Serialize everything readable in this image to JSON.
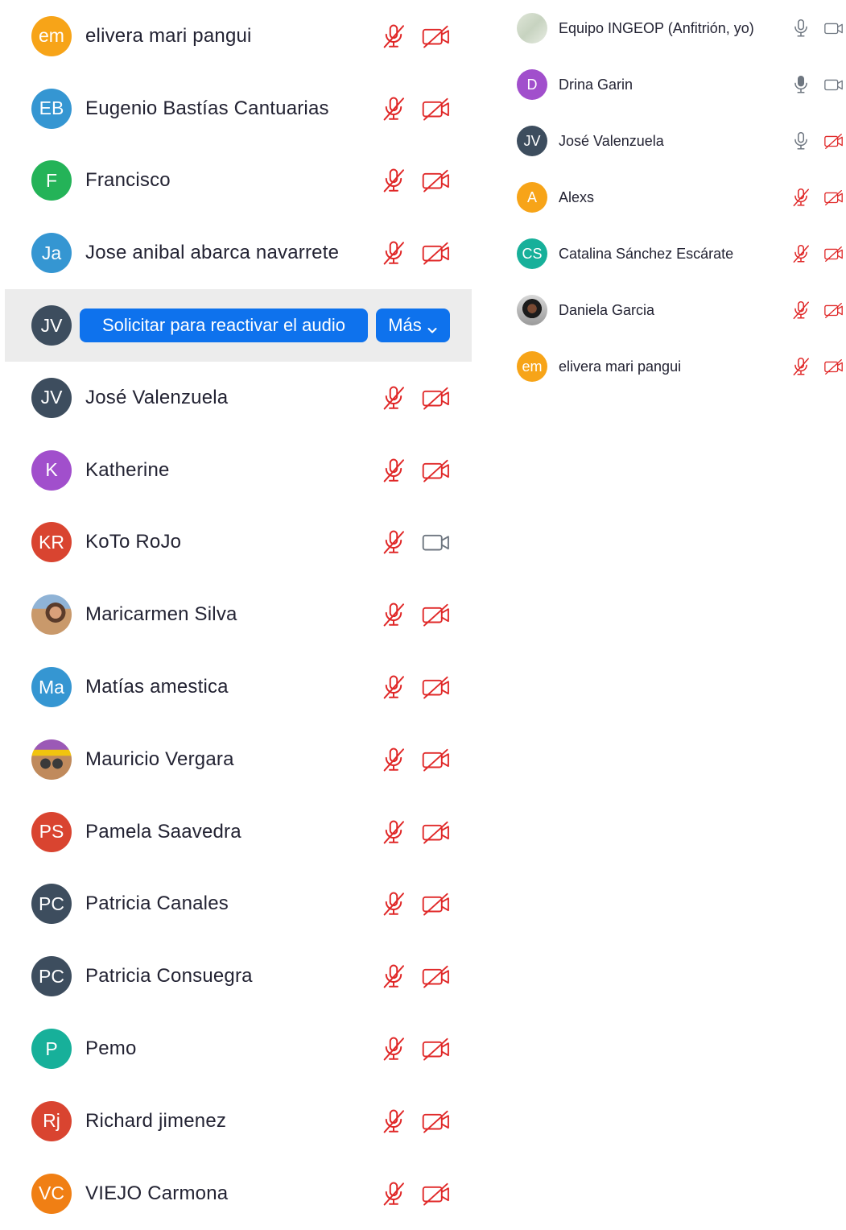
{
  "colors": {
    "muted_red": "#e02828",
    "icon_gray": "#6e7680",
    "button_blue": "#0e72ed",
    "hover_row": "#ececec"
  },
  "left_list": {
    "participants": [
      {
        "initials": "em",
        "name": "elivera mari pangui",
        "avatar_color": "#f7a418",
        "mic": "muted",
        "video": "off"
      },
      {
        "initials": "EB",
        "name": "Eugenio Bastías Cantuarias",
        "avatar_color": "#3596d2",
        "mic": "muted",
        "video": "off"
      },
      {
        "initials": "F",
        "name": "Francisco",
        "avatar_color": "#24b358",
        "mic": "muted",
        "video": "off"
      },
      {
        "initials": "Ja",
        "name": "Jose anibal abarca navarrete",
        "avatar_color": "#3596d2",
        "mic": "muted",
        "video": "off"
      },
      {
        "initials": "JV",
        "name": "",
        "avatar_color": "#3d4d5e",
        "hovered": true
      },
      {
        "initials": "JV",
        "name": "José Valenzuela",
        "avatar_color": "#3d4d5e",
        "mic": "muted",
        "video": "off"
      },
      {
        "initials": "K",
        "name": "Katherine",
        "avatar_color": "#a14fcc",
        "mic": "muted",
        "video": "off"
      },
      {
        "initials": "KR",
        "name": "KoTo RoJo",
        "avatar_color": "#d94430",
        "mic": "muted",
        "video": "on"
      },
      {
        "initials": "",
        "name": "Maricarmen Silva",
        "avatar_image": "photo-maricarmen",
        "mic": "muted",
        "video": "off"
      },
      {
        "initials": "Ma",
        "name": "Matías amestica",
        "avatar_color": "#3596d2",
        "mic": "muted",
        "video": "off"
      },
      {
        "initials": "",
        "name": "Mauricio Vergara",
        "avatar_image": "photo-mauricio",
        "mic": "muted",
        "video": "off"
      },
      {
        "initials": "PS",
        "name": "Pamela Saavedra",
        "avatar_color": "#d94430",
        "mic": "muted",
        "video": "off"
      },
      {
        "initials": "PC",
        "name": "Patricia Canales",
        "avatar_color": "#3d4d5e",
        "mic": "muted",
        "video": "off"
      },
      {
        "initials": "PC",
        "name": "Patricia Consuegra",
        "avatar_color": "#3d4d5e",
        "mic": "muted",
        "video": "off"
      },
      {
        "initials": "P",
        "name": "Pemo",
        "avatar_color": "#17b09a",
        "mic": "muted",
        "video": "off"
      },
      {
        "initials": "Rj",
        "name": "Richard jimenez",
        "avatar_color": "#d94430",
        "mic": "muted",
        "video": "off"
      },
      {
        "initials": "VC",
        "name": "VIEJO Carmona",
        "avatar_color": "#f07f14",
        "mic": "muted",
        "video": "off"
      }
    ],
    "hover_actions": {
      "unmute_label": "Solicitar para reactivar el audio",
      "more_label": "Más"
    }
  },
  "right_list": {
    "participants": [
      {
        "initials": "",
        "name": "Equipo INGEOP (Anfitrión, yo)",
        "avatar_image": "photo-ingeop",
        "mic": "on",
        "video": "on"
      },
      {
        "initials": "D",
        "name": "Drina Garin",
        "avatar_color": "#a14fcc",
        "mic": "on-filled",
        "video": "on"
      },
      {
        "initials": "JV",
        "name": "José Valenzuela",
        "avatar_color": "#3d4d5e",
        "mic": "on",
        "video": "off"
      },
      {
        "initials": "A",
        "name": "Alexs",
        "avatar_color": "#f7a418",
        "mic": "muted",
        "video": "off"
      },
      {
        "initials": "CS",
        "name": "Catalina Sánchez Escárate",
        "avatar_color": "#17b09a",
        "mic": "muted",
        "video": "off"
      },
      {
        "initials": "",
        "name": "Daniela Garcia",
        "avatar_image": "photo-daniela",
        "mic": "muted",
        "video": "off"
      },
      {
        "initials": "em",
        "name": "elivera mari pangui",
        "avatar_color": "#f7a418",
        "mic": "muted",
        "video": "off"
      }
    ]
  }
}
